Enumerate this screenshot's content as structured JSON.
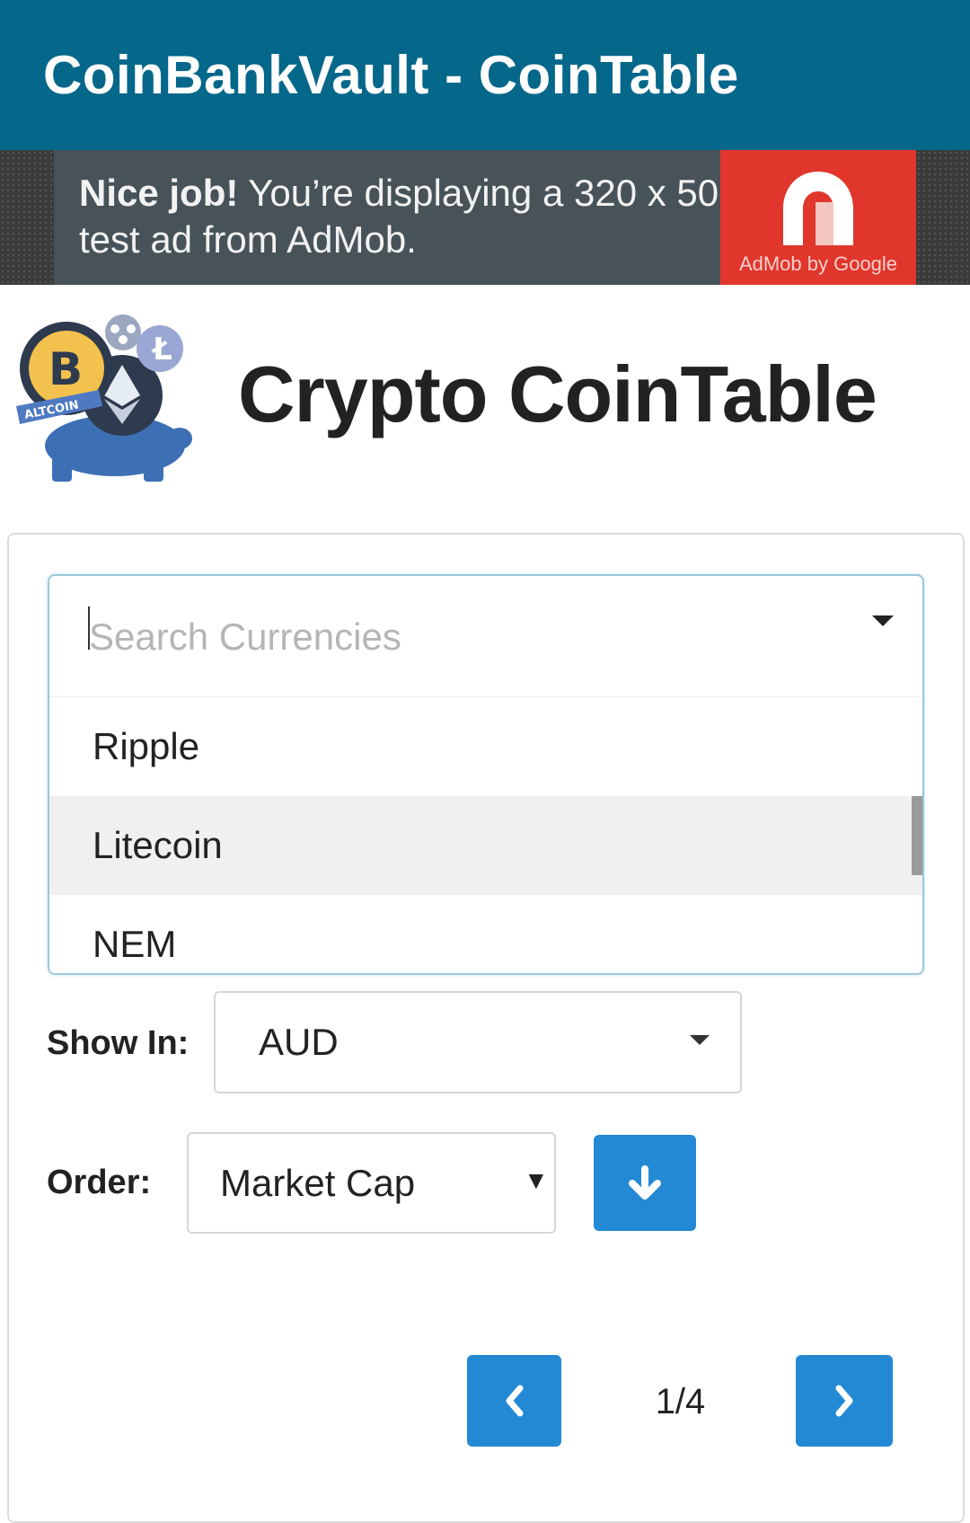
{
  "appbar": {
    "title": "CoinBankVault - CoinTable"
  },
  "ad": {
    "headline_bold": "Nice job!",
    "headline_rest": " You’re displaying a 320 x 50",
    "line2": "test ad from AdMob.",
    "brand": "AdMob by Google"
  },
  "header": {
    "title": "Crypto CoinTable",
    "logo_label": "ALTCOIN"
  },
  "search": {
    "placeholder": "Search Currencies",
    "value": "",
    "options": [
      "Ripple",
      "Litecoin",
      "NEM"
    ],
    "highlighted_option": "Litecoin"
  },
  "show_in": {
    "label": "Show In:",
    "value": "AUD"
  },
  "order": {
    "label": "Order:",
    "value": "Market Cap",
    "direction_icon": "arrow-down-icon"
  },
  "pagination": {
    "indicator": "1/4",
    "prev_icon": "chevron-left-icon",
    "next_icon": "chevron-right-icon"
  },
  "colors": {
    "appbar": "#05678a",
    "button_blue": "#2489d4",
    "ad_red": "#e0362c"
  }
}
